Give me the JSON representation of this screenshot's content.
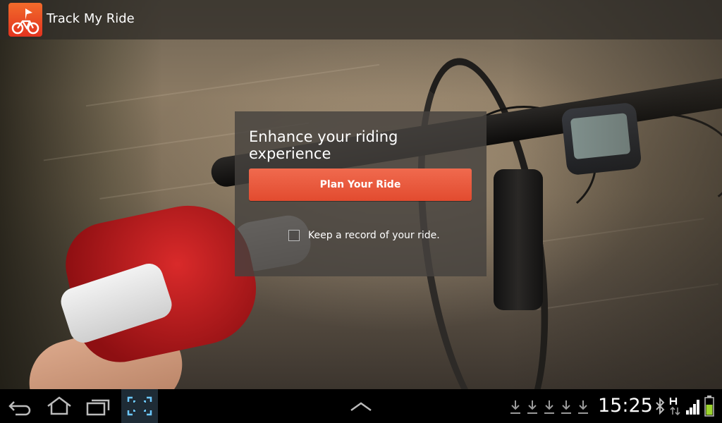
{
  "app": {
    "title": "Track My Ride",
    "icon": "navigation-arrow-bicycle-icon",
    "accent": "#E84A2E"
  },
  "card": {
    "heading": "Enhance your riding experience",
    "plan_button_label": "Plan Your Ride",
    "record_checkbox_label": "Keep a record of your ride.",
    "record_checked": false
  },
  "system_bar": {
    "nav": [
      "back-icon",
      "home-icon",
      "recent-apps-icon",
      "screenshot-icon"
    ],
    "center_icon": "chevron-up-icon",
    "notifications": [
      "download-icon",
      "download-icon",
      "download-icon",
      "download-icon",
      "download-icon"
    ],
    "time": "15:25",
    "status_icons": [
      "bluetooth-icon",
      "network-h-icon",
      "signal-icon",
      "battery-icon"
    ]
  }
}
